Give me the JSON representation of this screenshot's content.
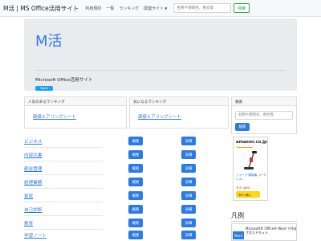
{
  "navbar": {
    "brand": "M活 | MS Office活用サイト",
    "links": [
      "利用規約",
      "一覧",
      "ランキング"
    ],
    "dropdown_label": "関連サイト",
    "search_placeholder": "名称や項目名、例文等",
    "search_button": "検索"
  },
  "jumbotron": {
    "title": "M活",
    "subtitle": "Microsoft Office活用サイト",
    "tweet_label": "Tweet"
  },
  "cards": {
    "popular": {
      "header": "人気のあるランキング",
      "link": "面接ヒアリングシート"
    },
    "watched": {
      "header": "気になるランキング",
      "link": "面接ヒアリングシート"
    },
    "search": {
      "header": "検索",
      "placeholder": "名称や項目名、例文等",
      "button": "検索"
    }
  },
  "list": {
    "overview_label": "概要",
    "detail_label": "詳細",
    "items": [
      "ビジネス",
      "内部文書",
      "勤怠管理",
      "経理業務",
      "家庭",
      "自己診断",
      "教育",
      "学習ノート"
    ]
  },
  "ad": {
    "brand": "amazon.co.jp",
    "product": "シャープ 掃除機 コードレス...",
    "price": "￥37,800",
    "buy_label": "今すぐ購入"
  },
  "legend": {
    "title": "凡例",
    "badge": "Word",
    "text": "Microsoft® Office® Word で作成されたドキュメ"
  },
  "colors": {
    "primary": "#2c7be5",
    "jumbotron_bg": "#e9ecef",
    "success": "#28a745",
    "twitter": "#1da1f2"
  }
}
